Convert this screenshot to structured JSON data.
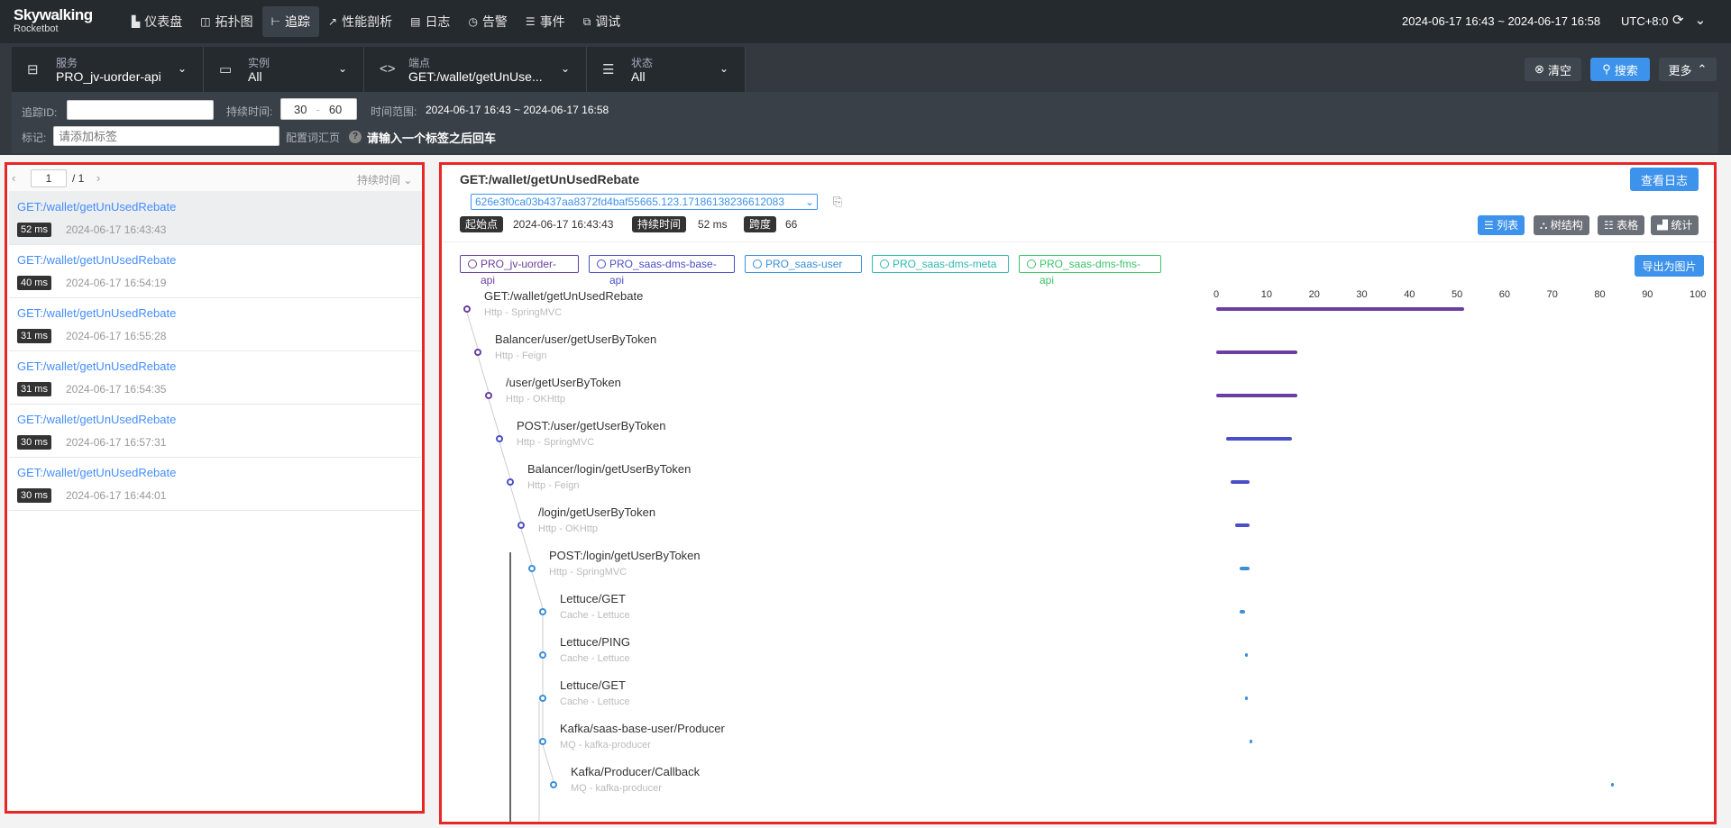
{
  "app": {
    "logo": "Skywalking",
    "logo_sub": "Rocketbot"
  },
  "nav": [
    {
      "label": "仪表盘",
      "icon": "dashboard-icon",
      "glyph": "▙"
    },
    {
      "label": "拓扑图",
      "icon": "topology-icon",
      "glyph": "◫"
    },
    {
      "label": "追踪",
      "icon": "trace-icon",
      "glyph": "⊢"
    },
    {
      "label": "性能剖析",
      "icon": "profile-icon",
      "glyph": "↗"
    },
    {
      "label": "日志",
      "icon": "log-icon",
      "glyph": "▤"
    },
    {
      "label": "告警",
      "icon": "alarm-icon",
      "glyph": "◷"
    },
    {
      "label": "事件",
      "icon": "event-icon",
      "glyph": "☰"
    },
    {
      "label": "调试",
      "icon": "debug-icon",
      "glyph": "⧉"
    }
  ],
  "header": {
    "time_range": "2024-06-17 16:43 ~ 2024-06-17 16:58",
    "timezone": "UTC+8:0"
  },
  "filters": {
    "service": {
      "label": "服务",
      "value": "PRO_jv-uorder-api"
    },
    "instance": {
      "label": "实例",
      "value": "All"
    },
    "endpoint": {
      "label": "端点",
      "value": "GET:/wallet/getUnUse..."
    },
    "status": {
      "label": "状态",
      "value": "All"
    },
    "trace_id_label": "追踪ID:",
    "trace_id_value": "",
    "duration_label": "持续时间:",
    "duration_min": "30",
    "duration_sep": "-",
    "duration_max": "60",
    "time_range_label": "时间范围:",
    "time_range_value": "2024-06-17 16:43 ~ 2024-06-17 16:58",
    "tags_label": "标记:",
    "tags_placeholder": "请添加标签",
    "tag_vocab_label": "配置词汇页",
    "tag_tip": "请输入一个标签之后回车"
  },
  "actions": {
    "clear": "清空",
    "search": "搜索",
    "more": "更多"
  },
  "list": {
    "page": "1",
    "total_pages": "/ 1",
    "sort_label": "持续时间",
    "items": [
      {
        "name": "GET:/wallet/getUnUsedRebate",
        "duration": "52 ms",
        "time": "2024-06-17 16:43:43"
      },
      {
        "name": "GET:/wallet/getUnUsedRebate",
        "duration": "40 ms",
        "time": "2024-06-17 16:54:19"
      },
      {
        "name": "GET:/wallet/getUnUsedRebate",
        "duration": "31 ms",
        "time": "2024-06-17 16:55:28"
      },
      {
        "name": "GET:/wallet/getUnUsedRebate",
        "duration": "31 ms",
        "time": "2024-06-17 16:54:35"
      },
      {
        "name": "GET:/wallet/getUnUsedRebate",
        "duration": "30 ms",
        "time": "2024-06-17 16:57:31"
      },
      {
        "name": "GET:/wallet/getUnUsedRebate",
        "duration": "30 ms",
        "time": "2024-06-17 16:44:01"
      }
    ]
  },
  "detail": {
    "title": "GET:/wallet/getUnUsedRebate",
    "view_logs": "查看日志",
    "trace_id": "626e3f0ca03b437aa8372fd4baf55665.123.17186138236612083",
    "start_label": "起始点",
    "start_value": "2024-06-17 16:43:43",
    "duration_label": "持续时间",
    "duration_value": "52 ms",
    "spans_label": "跨度",
    "spans_value": "66",
    "views": [
      "列表",
      "树结构",
      "表格",
      "统计"
    ],
    "export": "导出为图片",
    "services": [
      {
        "name": "PRO_jv-uorder-api",
        "color": "#6b3fa0"
      },
      {
        "name": "PRO_saas-dms-base-api",
        "color": "#4a4fc7"
      },
      {
        "name": "PRO_saas-user",
        "color": "#3a8fd9"
      },
      {
        "name": "PRO_saas-dms-meta",
        "color": "#2fb9b0"
      },
      {
        "name": "PRO_saas-dms-fms-api",
        "color": "#3cc46a"
      }
    ],
    "axis_ticks": [
      "0",
      "10",
      "20",
      "30",
      "40",
      "50",
      "60",
      "70",
      "80",
      "90",
      "100"
    ],
    "spans": [
      {
        "name": "GET:/wallet/getUnUsedRebate",
        "sub": "Http - SpringMVC",
        "depth": 0,
        "start": 0,
        "end": 52,
        "color": "#6b3fa0"
      },
      {
        "name": "Balancer/user/getUserByToken",
        "sub": "Http - Feign",
        "depth": 1,
        "start": 0,
        "end": 17,
        "color": "#6b3fa0"
      },
      {
        "name": "/user/getUserByToken",
        "sub": "Http - OKHttp",
        "depth": 2,
        "start": 0,
        "end": 17,
        "color": "#6b3fa0"
      },
      {
        "name": "POST:/user/getUserByToken",
        "sub": "Http - SpringMVC",
        "depth": 3,
        "start": 2,
        "end": 16,
        "color": "#4a4fc7"
      },
      {
        "name": "Balancer/login/getUserByToken",
        "sub": "Http - Feign",
        "depth": 4,
        "start": 3,
        "end": 7,
        "color": "#4a4fc7"
      },
      {
        "name": "/login/getUserByToken",
        "sub": "Http - OKHttp",
        "depth": 5,
        "start": 4,
        "end": 7,
        "color": "#4a4fc7"
      },
      {
        "name": "POST:/login/getUserByToken",
        "sub": "Http - SpringMVC",
        "depth": 6,
        "start": 5,
        "end": 7,
        "color": "#3a8fd9"
      },
      {
        "name": "Lettuce/GET",
        "sub": "Cache - Lettuce",
        "depth": 7,
        "start": 5,
        "end": 6,
        "color": "#3a8fd9"
      },
      {
        "name": "Lettuce/PING",
        "sub": "Cache - Lettuce",
        "depth": 7,
        "start": 6,
        "end": 6.3,
        "color": "#3a8fd9"
      },
      {
        "name": "Lettuce/GET",
        "sub": "Cache - Lettuce",
        "depth": 7,
        "start": 6,
        "end": 6.3,
        "color": "#3a8fd9"
      },
      {
        "name": "Kafka/saas-base-user/Producer",
        "sub": "MQ - kafka-producer",
        "depth": 7,
        "start": 7,
        "end": 7.3,
        "color": "#3a8fd9"
      },
      {
        "name": "Kafka/Producer/Callback",
        "sub": "MQ - kafka-producer",
        "depth": 8,
        "start": 83,
        "end": 83.3,
        "color": "#3a8fd9"
      }
    ]
  }
}
